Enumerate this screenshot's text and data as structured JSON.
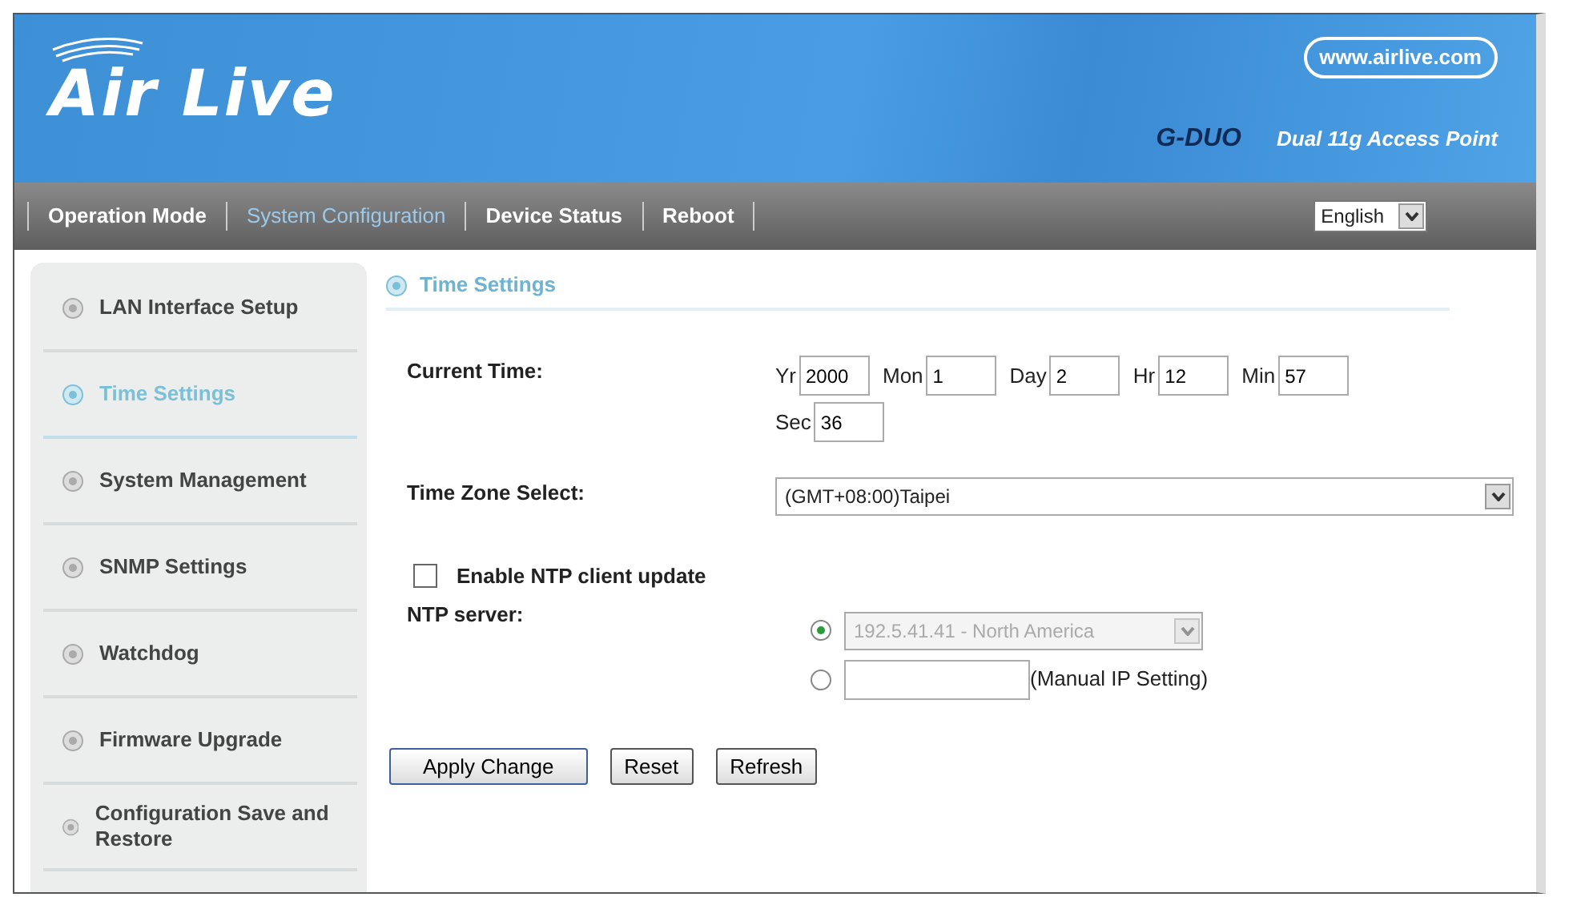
{
  "header": {
    "logo": "Air Live",
    "website": "www.airlive.com",
    "model": "G-DUO",
    "product": "Dual 11g Access Point"
  },
  "nav": [
    {
      "label": "Operation Mode",
      "selected": false
    },
    {
      "label": "System Configuration",
      "selected": true
    },
    {
      "label": "Device Status",
      "selected": false
    },
    {
      "label": "Reboot",
      "selected": false
    }
  ],
  "language": {
    "value": "English"
  },
  "sidebar": {
    "items": [
      {
        "label": "LAN Interface Setup",
        "selected": false
      },
      {
        "label": "Time Settings",
        "selected": true
      },
      {
        "label": "System Management",
        "selected": false
      },
      {
        "label": "SNMP Settings",
        "selected": false
      },
      {
        "label": "Watchdog",
        "selected": false
      },
      {
        "label": "Firmware Upgrade",
        "selected": false
      },
      {
        "label": "Configuration Save and Restore",
        "selected": false
      }
    ]
  },
  "section_title": "Time Settings",
  "current_time": {
    "label": "Current Time:",
    "fields": [
      {
        "label": "Yr",
        "value": "2000"
      },
      {
        "label": "Mon",
        "value": "1"
      },
      {
        "label": "Day",
        "value": "2"
      },
      {
        "label": "Hr",
        "value": "12"
      },
      {
        "label": "Min",
        "value": "57"
      },
      {
        "label": "Sec",
        "value": "36"
      }
    ]
  },
  "time_zone": {
    "label": "Time Zone Select:",
    "value": "(GMT+08:00)Taipei"
  },
  "ntp_enable": {
    "label": "Enable NTP client update",
    "checked": false
  },
  "ntp_server": {
    "label": "NTP server:",
    "options": [
      {
        "kind": "select",
        "selected": true,
        "value": "192.5.41.41 - North America",
        "disabled": true
      },
      {
        "kind": "input",
        "selected": false,
        "note": "(Manual IP Setting)"
      }
    ]
  },
  "buttons": [
    "Apply Change",
    "Reset",
    "Refresh"
  ]
}
